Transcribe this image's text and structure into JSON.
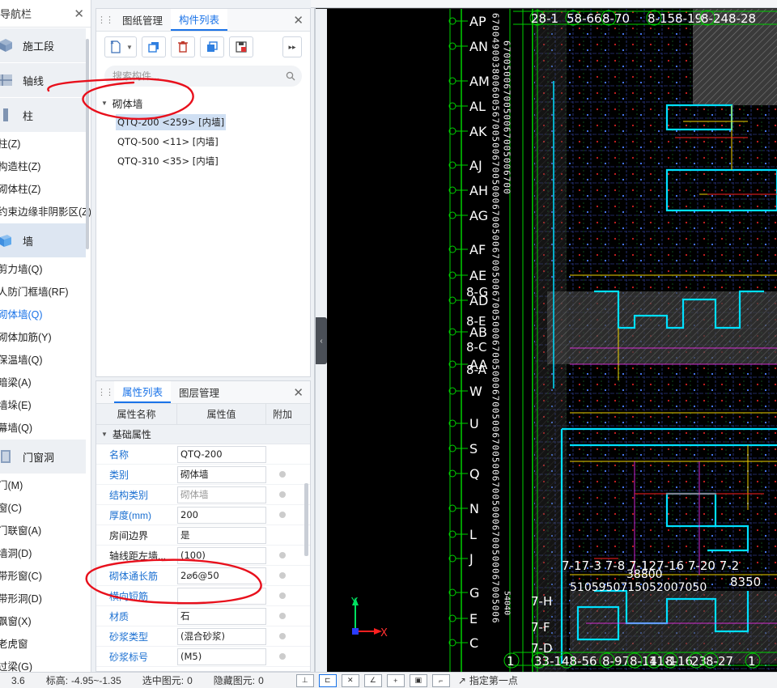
{
  "nav": {
    "title": "导航栏",
    "categories": [
      {
        "label": "施工段",
        "icon": "segment-icon"
      },
      {
        "label": "轴线",
        "icon": "axis-icon"
      },
      {
        "label": "柱",
        "icon": "column-icon"
      }
    ],
    "column_items": [
      "柱(Z)",
      "构造柱(Z)",
      "砌体柱(Z)",
      "约束边缘非阴影区(Z)"
    ],
    "wall_category": "墙",
    "wall_items": [
      "剪力墙(Q)",
      "人防门框墙(RF)",
      "砌体墙(Q)",
      "砌体加筋(Y)",
      "保温墙(Q)",
      "暗梁(A)",
      "墙垛(E)",
      "幕墙(Q)"
    ],
    "door_category": "门窗洞",
    "door_items": [
      "门(M)",
      "窗(C)",
      "门联窗(A)",
      "墙洞(D)",
      "带形窗(C)",
      "带形洞(D)",
      "飘窗(X)",
      "老虎窗",
      "过梁(G)"
    ]
  },
  "component_panel": {
    "tabs": [
      "图纸管理",
      "构件列表"
    ],
    "active_tab": 1,
    "search_placeholder": "搜索构件...",
    "group": "砌体墙",
    "items": [
      "QTQ-200 <259> [内墙]",
      "QTQ-500 <11> [内墙]",
      "QTQ-310 <35> [内墙]"
    ],
    "selected_item": 0
  },
  "property_panel": {
    "tabs": [
      "属性列表",
      "图层管理"
    ],
    "columns": [
      "属性名称",
      "属性值",
      "附加"
    ],
    "group": "基础属性",
    "rows": [
      {
        "name": "名称",
        "value": "QTQ-200",
        "radio": false,
        "blue": true
      },
      {
        "name": "类别",
        "value": "砌体墙",
        "radio": true,
        "blue": true
      },
      {
        "name": "结构类别",
        "value": "砌体墙",
        "radio": true,
        "blue": true,
        "disabled": true
      },
      {
        "name": "厚度(mm)",
        "value": "200",
        "radio": true,
        "blue": true
      },
      {
        "name": "房间边界",
        "value": "是",
        "radio": false,
        "blue": false
      },
      {
        "name": "轴线距左墙...",
        "value": "(100)",
        "radio": true,
        "blue": false
      },
      {
        "name": "砌体通长筋",
        "value": "2⌀6@50",
        "radio": true,
        "blue": true
      },
      {
        "name": "横向短筋",
        "value": "",
        "radio": true,
        "blue": true
      },
      {
        "name": "材质",
        "value": "石",
        "radio": true,
        "blue": true
      },
      {
        "name": "砂浆类型",
        "value": "(混合砂浆)",
        "radio": true,
        "blue": true
      },
      {
        "name": "砂浆标号",
        "value": "(M5)",
        "radio": true,
        "blue": true
      }
    ]
  },
  "cad": {
    "axis_labels": [
      "AP",
      "AN",
      "AM",
      "AL",
      "AK",
      "AJ",
      "AH",
      "AG",
      "AF",
      "AE",
      "AD",
      "AB",
      "AA",
      "W",
      "U",
      "S",
      "Q",
      "N",
      "L",
      "J",
      "G",
      "E",
      "C"
    ],
    "top_labels": [
      "28-1",
      "58-66",
      "8-70",
      "8-158-19",
      "8-248-28"
    ],
    "bottom_labels": [
      "1",
      "33-1",
      "48-56",
      "8-97",
      "8-14",
      "11-1",
      "8-16",
      "23",
      "8-27",
      "1"
    ],
    "dims_row1": [
      "7-17-3",
      "7-8",
      "7-127-16",
      "7-20",
      "7-2"
    ],
    "dims_row2": "5105950715052007050",
    "dims_row2b": "8350",
    "dim_38800": "38800",
    "side_labels": [
      "8-G",
      "8-E",
      "8-C",
      "8-A",
      "7-H",
      "7-F",
      "7-D"
    ],
    "ucs_x": "X",
    "ucs_y": "Y"
  },
  "status": {
    "scale": "3.6",
    "elevation_label": "标高:",
    "elevation": "-4.95~-1.35",
    "selected_label": "选中图元:",
    "selected": "0",
    "hidden_label": "隐藏图元:",
    "hidden": "0",
    "hint": "指定第一点"
  },
  "colors": {
    "accent": "#1a73e8",
    "cad_bg": "#000000",
    "axis_green": "#00d000",
    "wall_cyan": "#00e0ff",
    "annotation_red": "#e8101c"
  }
}
